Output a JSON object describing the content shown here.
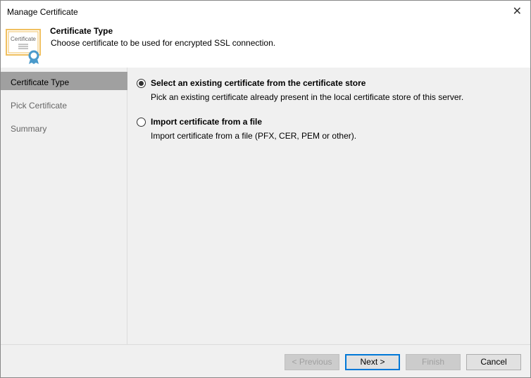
{
  "window": {
    "title": "Manage Certificate",
    "close": "✕"
  },
  "header": {
    "title": "Certificate Type",
    "description": "Choose certificate to be used for encrypted SSL connection.",
    "icon_text": "Certificate"
  },
  "sidebar": {
    "items": [
      {
        "label": "Certificate Type"
      },
      {
        "label": "Pick Certificate"
      },
      {
        "label": "Summary"
      }
    ]
  },
  "options": [
    {
      "label": "Select an existing certificate from the certificate store",
      "description": "Pick an existing certificate already present in the local certificate store of this server.",
      "selected": true
    },
    {
      "label": "Import certificate from a file",
      "description": "Import certificate from a file (PFX, CER, PEM or other).",
      "selected": false
    }
  ],
  "buttons": {
    "previous": "< Previous",
    "next": "Next >",
    "finish": "Finish",
    "cancel": "Cancel"
  },
  "colors": {
    "accent": "#0078d7",
    "icon_gold": "#f0c060",
    "icon_ribbon": "#4a9acb"
  }
}
